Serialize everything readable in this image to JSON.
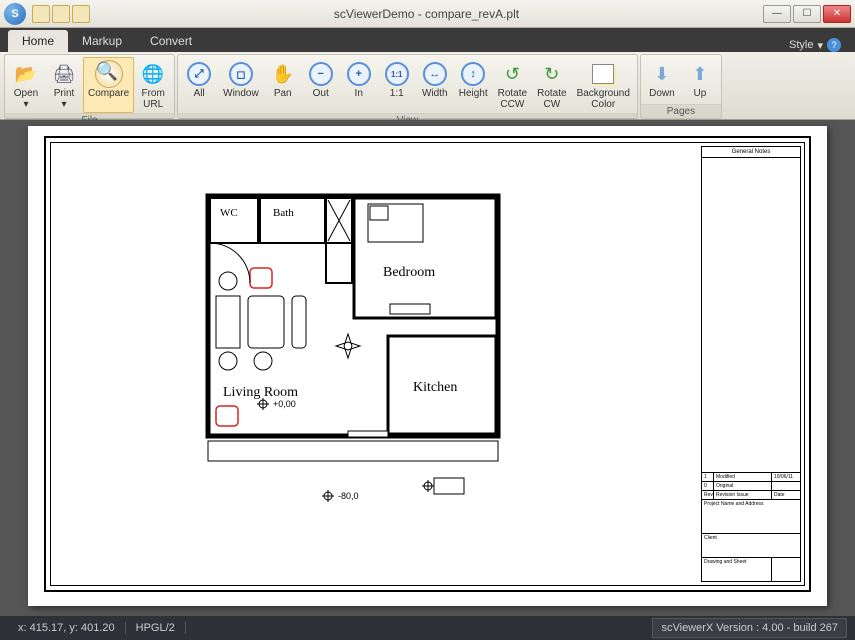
{
  "app": {
    "title": "scViewerDemo - compare_revA.plt"
  },
  "tabs": [
    {
      "label": "Home",
      "active": true
    },
    {
      "label": "Markup",
      "active": false
    },
    {
      "label": "Convert",
      "active": false
    }
  ],
  "style_menu": "Style",
  "ribbon": {
    "groups": [
      {
        "name": "File",
        "buttons": [
          {
            "id": "open",
            "label": "Open\n▾",
            "icon": "open"
          },
          {
            "id": "print",
            "label": "Print\n▾",
            "icon": "print"
          },
          {
            "id": "compare",
            "label": "Compare",
            "icon": "compare",
            "active": true
          },
          {
            "id": "from-url",
            "label": "From\nURL",
            "icon": "url"
          }
        ]
      },
      {
        "name": "View",
        "buttons": [
          {
            "id": "zoom-all",
            "label": "All",
            "icon": "zoom",
            "glyph": "⤢"
          },
          {
            "id": "zoom-window",
            "label": "Window",
            "icon": "zoom",
            "glyph": "◻"
          },
          {
            "id": "pan",
            "label": "Pan",
            "icon": "hand",
            "glyph": "✋"
          },
          {
            "id": "zoom-out",
            "label": "Out",
            "icon": "zoom",
            "glyph": "−"
          },
          {
            "id": "zoom-in",
            "label": "In",
            "icon": "zoom",
            "glyph": "+"
          },
          {
            "id": "zoom-11",
            "label": "1:1",
            "icon": "zoom",
            "glyph": "1:1"
          },
          {
            "id": "zoom-width",
            "label": "Width",
            "icon": "zoom",
            "glyph": "↔"
          },
          {
            "id": "zoom-height",
            "label": "Height",
            "icon": "zoom",
            "glyph": "↕"
          },
          {
            "id": "rotate-ccw",
            "label": "Rotate\nCCW",
            "icon": "rot",
            "glyph": "↺"
          },
          {
            "id": "rotate-cw",
            "label": "Rotate\nCW",
            "icon": "rot",
            "glyph": "↻"
          },
          {
            "id": "bg-color",
            "label": "Background\nColor",
            "icon": "bgc"
          }
        ]
      },
      {
        "name": "Pages",
        "buttons": [
          {
            "id": "page-down",
            "label": "Down",
            "icon": "arrow-down",
            "glyph": "⬇"
          },
          {
            "id": "page-up",
            "label": "Up",
            "icon": "arrow-up",
            "glyph": "⬆"
          }
        ]
      }
    ]
  },
  "floorplan": {
    "rooms": {
      "wc": "WC",
      "bath": "Bath",
      "bedroom": "Bedroom",
      "living": "Living Room",
      "kitchen": "Kitchen"
    },
    "dims": {
      "a": "+0,00",
      "b": "-80,0"
    }
  },
  "titleblock": {
    "header": "General Notes",
    "rows": [
      {
        "c1": "1",
        "c2": "Modified",
        "c3": "10/06/11"
      },
      {
        "c1": "0",
        "c2": "Original",
        "c3": ""
      },
      {
        "c1": "Rev",
        "c2": "Revision Issue",
        "c3": "Date"
      }
    ],
    "proj": "Project Name and Address",
    "client": "Client",
    "drawn": "Drawing and Sheet"
  },
  "status": {
    "coords": "x: 415.17, y: 401.20",
    "format": "HPGL/2",
    "version": "scViewerX Version : 4.00 - build 267"
  }
}
